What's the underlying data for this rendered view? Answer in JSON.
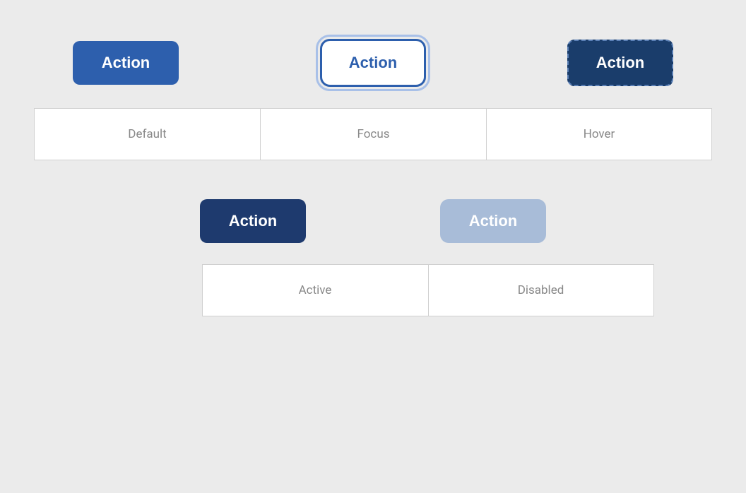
{
  "background_color": "#ebebeb",
  "row1": {
    "buttons": [
      {
        "id": "default",
        "label": "Action",
        "state": "default"
      },
      {
        "id": "focus",
        "label": "Action",
        "state": "focus"
      },
      {
        "id": "hover",
        "label": "Action",
        "state": "hover"
      }
    ],
    "labels": [
      "Default",
      "Focus",
      "Hover"
    ]
  },
  "row2": {
    "buttons": [
      {
        "id": "active",
        "label": "Action",
        "state": "active"
      },
      {
        "id": "disabled",
        "label": "Action",
        "state": "disabled"
      }
    ],
    "labels": [
      "Active",
      "Disabled"
    ]
  }
}
